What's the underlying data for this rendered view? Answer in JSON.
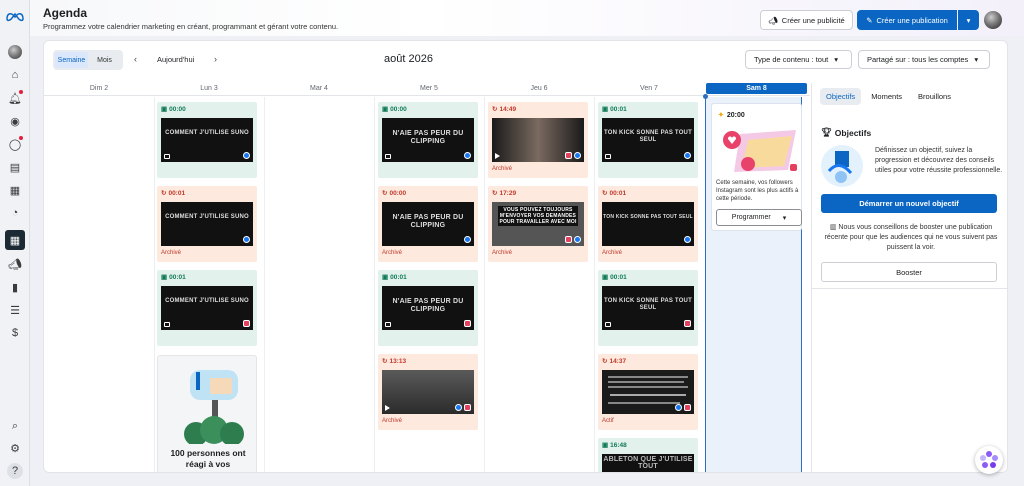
{
  "header": {
    "title": "Agenda",
    "subtitle": "Programmez votre calendrier marketing en créant, programmant et gérant votre contenu.",
    "create_ad_label": "Créer une publicité",
    "create_post_label": "Créer une publication"
  },
  "toolbar": {
    "view_week": "Semaine",
    "view_month": "Mois",
    "today_label": "Aujourd'hui",
    "month_label": "août 2026",
    "content_type_label": "Type de contenu : tout",
    "shared_on_label": "Partagé sur : tous les comptes"
  },
  "days": [
    "Dim 2",
    "Lun 3",
    "Mar 4",
    "Mer 5",
    "Jeu 6",
    "Ven 7",
    "Sam 8"
  ],
  "posts": {
    "lun": [
      {
        "time": "00:00",
        "caption": "COMMENT J'UTILISE SUNO",
        "status": ""
      },
      {
        "time": "00:01",
        "caption": "COMMENT J'UTILISE SUNO",
        "status": "Archivé"
      },
      {
        "time": "00:01",
        "caption": "COMMENT J'UTILISE SUNO",
        "status": ""
      }
    ],
    "mer": [
      {
        "time": "00:00",
        "caption": "N'AIE PAS PEUR DU CLIPPING",
        "status": ""
      },
      {
        "time": "00:00",
        "caption": "N'AIE PAS PEUR DU CLIPPING",
        "status": "Archivé"
      },
      {
        "time": "00:01",
        "caption": "N'AIE PAS PEUR DU CLIPPING",
        "status": ""
      },
      {
        "time": "13:13",
        "caption": "",
        "status": "Archivé"
      }
    ],
    "jeu": [
      {
        "time": "14:49",
        "caption": "",
        "status": "Archivé"
      },
      {
        "time": "17:29",
        "caption": "VOUS POUVEZ TOUJOURS M'ENVOYER VOS DEMANDES POUR TRAVAILLER AVEC MOI",
        "status": "Archivé"
      }
    ],
    "ven": [
      {
        "time": "00:01",
        "caption": "TON KICK SONNE PAS TOUT SEUL",
        "status": ""
      },
      {
        "time": "00:01",
        "caption": "TON KICK SONNE PAS TOUT SEUL",
        "status": "Archivé"
      },
      {
        "time": "00:01",
        "caption": "TON KICK SONNE PAS TOUT SEUL",
        "status": ""
      },
      {
        "time": "14:37",
        "caption": "",
        "status": "Actif"
      },
      {
        "time": "16:48",
        "caption": "ABLETON QUE J'UTILISE TOUT",
        "status": ""
      }
    ]
  },
  "promo": {
    "text": "100 personnes ont réagi à vos"
  },
  "saturday": {
    "time": "20:00",
    "desc": "Cette semaine, vos followers Instagram sont les plus actifs à cette période.",
    "program_label": "Programmer"
  },
  "right_panel": {
    "tabs": [
      "Objectifs",
      "Moments",
      "Brouillons"
    ],
    "objectives_title": "Objectifs",
    "objectives_text": "Définissez un objectif, suivez la progression et découvrez des conseils utiles pour votre réussite professionnelle.",
    "start_goal_label": "Démarrer un nouvel objectif",
    "boost_text": "Nous vous conseillons de booster une publication récente pour que les audiences qui ne vous suivent pas puissent la voir.",
    "boost_label": "Booster"
  },
  "colors": {
    "primary": "#0a66c2",
    "green_card": "#e2f1ec",
    "orange_card": "#fde9dd"
  }
}
